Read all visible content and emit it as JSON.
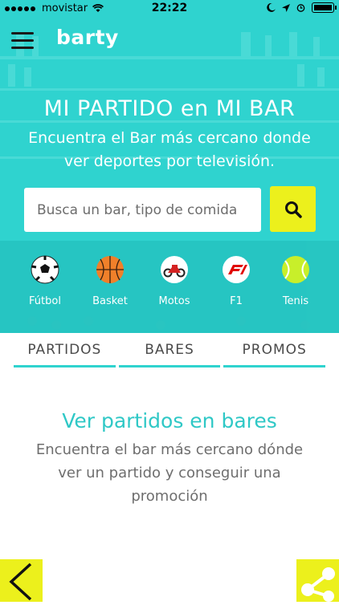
{
  "status_bar": {
    "carrier": "movistar",
    "time": "22:22"
  },
  "app": {
    "logo": "barty"
  },
  "hero": {
    "title": "MI PARTIDO en MI BAR",
    "subtitle": "Encuentra el Bar más cercano donde ver deportes por televisión."
  },
  "search": {
    "placeholder": "Busca un bar, tipo de comida"
  },
  "sports": [
    {
      "label": "Fútbol",
      "icon": "soccer-ball-icon"
    },
    {
      "label": "Basket",
      "icon": "basketball-icon"
    },
    {
      "label": "Motos",
      "icon": "motorbike-icon"
    },
    {
      "label": "F1",
      "icon": "f1-icon"
    },
    {
      "label": "Tenis",
      "icon": "tennis-ball-icon"
    }
  ],
  "tabs": [
    {
      "label": "PARTIDOS"
    },
    {
      "label": "BARES"
    },
    {
      "label": "PROMOS"
    }
  ],
  "content": {
    "title": "Ver partidos en bares",
    "text": "Encuentra el bar más cercano dónde ver un partido y conseguir una promoción"
  },
  "colors": {
    "teal": "#2fd3cf",
    "yellow": "#ecf01c",
    "text_grey": "#6e6e6e"
  }
}
